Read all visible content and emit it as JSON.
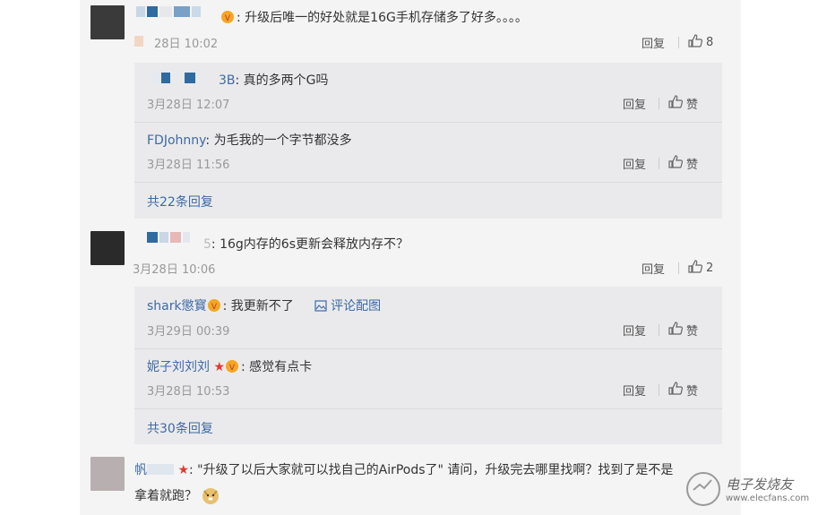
{
  "comments": [
    {
      "text": ": 升级后唯一的好处就是16G手机存储多了好多。。。。",
      "time": "28日 10:02",
      "reply_label": "回复",
      "like_count": "8"
    },
    {
      "text": ": 16g内存的6s更新会释放内存不？",
      "time": "3月28日 10:06",
      "reply_label": "回复",
      "like_count": "2"
    },
    {
      "text_line1": ": \"升级了以后大家就可以找自己的AirPods了\" 请问，升级完去哪里找啊？找到了是不是",
      "text_line2": "拿着就跑？"
    }
  ],
  "replies_1": [
    {
      "name_tail": "3B",
      "text": ": 真的多两个G吗",
      "time": "3月28日 12:07",
      "reply_label": "回复",
      "like_label": "赞"
    },
    {
      "name": "FDJohnny",
      "text": ": 为毛我的一个字节都没多",
      "time": "3月28日 11:56",
      "reply_label": "回复",
      "like_label": "赞"
    }
  ],
  "replies_1_more": "共22条回复",
  "replies_2": [
    {
      "name": "shark懲寳",
      "text": ": 我更新不了",
      "link": "评论配图",
      "time": "3月29日 00:39",
      "reply_label": "回复",
      "like_label": "赞"
    },
    {
      "name": "妮子刘刘刘",
      "text": ": 感觉有点卡",
      "time": "3月28日 10:53",
      "reply_label": "回复",
      "like_label": "赞"
    }
  ],
  "replies_2_more": "共30条回复",
  "comment2_name_tail": "5",
  "comment3_name_head": "帆",
  "watermark": {
    "line1": "电子发烧友",
    "line2": "www.elecfans.com"
  },
  "colors": {
    "link": "#3d6aa5",
    "panel": "#f4f4f5",
    "reply_box": "#eaeaec",
    "star": "#e03a2f"
  }
}
